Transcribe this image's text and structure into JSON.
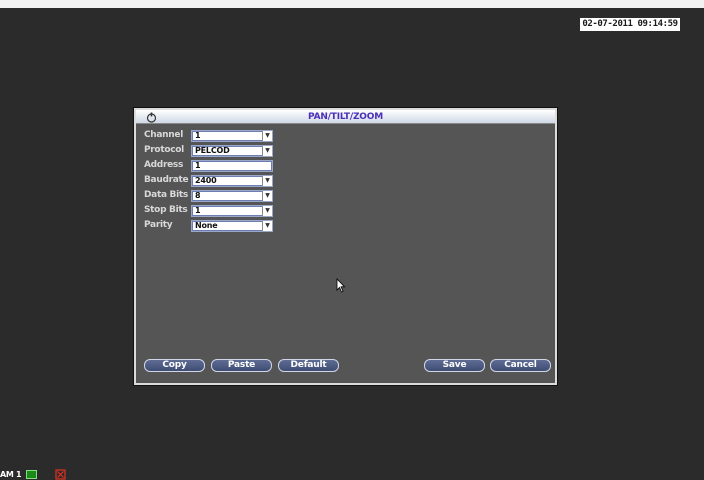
{
  "screen": {
    "datetime": "02-07-2011 09:14:59"
  },
  "dialog": {
    "title": "PAN/TILT/ZOOM",
    "fields": [
      {
        "label": "Channel",
        "value": "1",
        "type": "select"
      },
      {
        "label": "Protocol",
        "value": "PELCOD",
        "type": "select"
      },
      {
        "label": "Address",
        "value": "1",
        "type": "input"
      },
      {
        "label": "Baudrate",
        "value": "2400",
        "type": "select"
      },
      {
        "label": "Data Bits",
        "value": "8",
        "type": "select"
      },
      {
        "label": "Stop Bits",
        "value": "1",
        "type": "select"
      },
      {
        "label": "Parity",
        "value": "None",
        "type": "select"
      }
    ],
    "buttons": {
      "copy": "Copy",
      "paste": "Paste",
      "default": "Default",
      "save": "Save",
      "cancel": "Cancel"
    }
  },
  "status": {
    "camera_label": "AM 1"
  },
  "colors": {
    "title_text": "#4a2fb8",
    "dialog_bg": "#555555",
    "button_bg": "#4e5b84",
    "record_indicator": "#1b8a1b",
    "motion_indicator": "#e03020"
  },
  "icons": {
    "title": "ptz-hand-icon",
    "record": "record-indicator-icon",
    "motion": "motion-alarm-icon",
    "cursor": "mouse-pointer-icon"
  }
}
